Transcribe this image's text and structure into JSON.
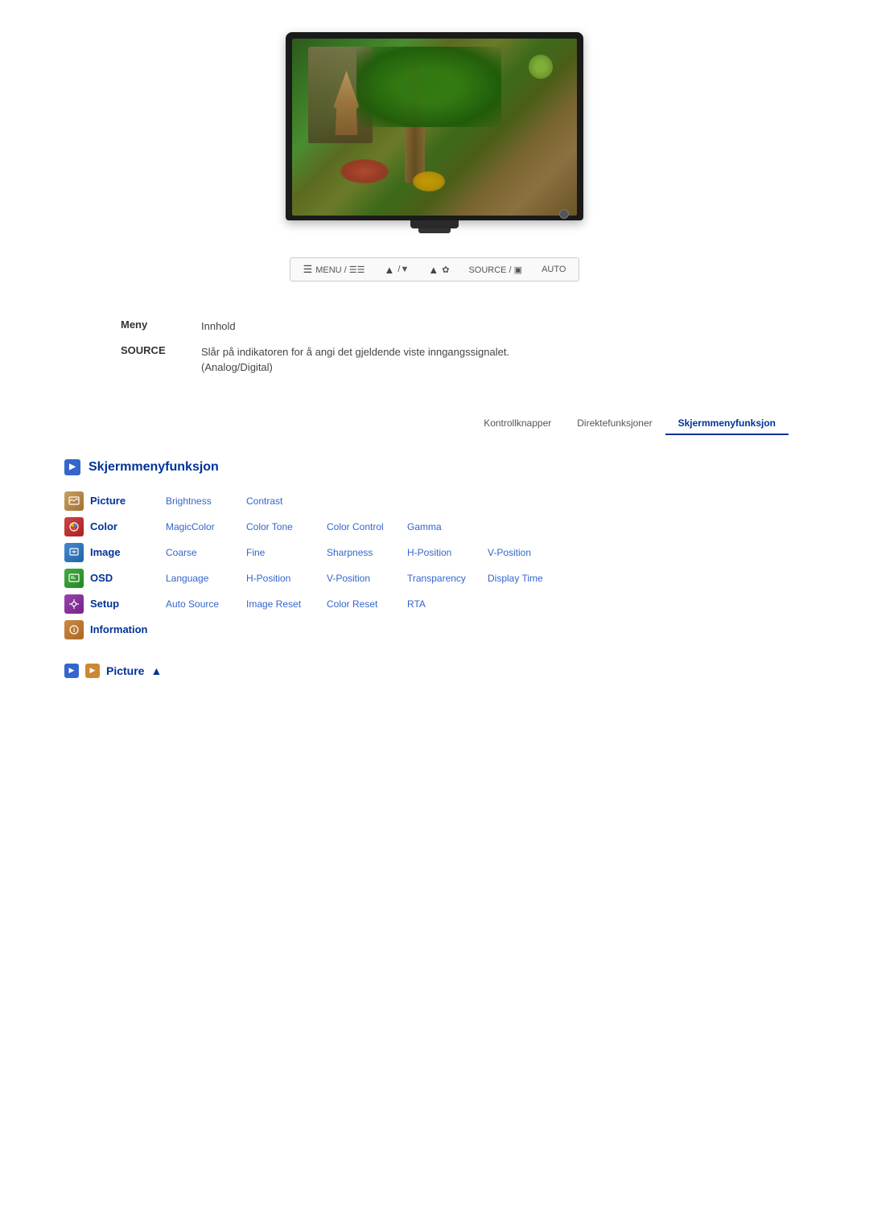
{
  "monitor": {
    "alt": "Samsung monitor displaying garden scene"
  },
  "control_bar": {
    "items": [
      {
        "label": "MENU / ☰☰☰",
        "icon": "menu-icon"
      },
      {
        "label": "▲/▼",
        "icon": "updown-icon"
      },
      {
        "label": "▲ ✿",
        "icon": "brightness-icon"
      },
      {
        "label": "SOURCE / ▣",
        "icon": "source-icon"
      },
      {
        "label": "AUTO",
        "icon": "auto-icon"
      }
    ]
  },
  "info_table": {
    "rows": [
      {
        "label": "Meny",
        "value": "Innhold"
      },
      {
        "label": "SOURCE",
        "value": "Slår på indikatoren for å angi det gjeldende viste inngangssignalet.\n(Analog/Digital)"
      }
    ]
  },
  "tabs": [
    {
      "label": "Kontrollknapper",
      "active": false
    },
    {
      "label": "Direktefunksjoner",
      "active": false
    },
    {
      "label": "Skjermmenyfunksjon",
      "active": true
    }
  ],
  "section": {
    "icon": "▶",
    "title": "Skjermmenyfunksjon"
  },
  "menu_rows": [
    {
      "icon_type": "picture",
      "label": "Picture",
      "items": [
        "Brightness",
        "Contrast"
      ]
    },
    {
      "icon_type": "color",
      "label": "Color",
      "items": [
        "MagicColor",
        "Color Tone",
        "Color Control",
        "Gamma"
      ]
    },
    {
      "icon_type": "image",
      "label": "Image",
      "items": [
        "Coarse",
        "Fine",
        "Sharpness",
        "H-Position",
        "V-Position"
      ]
    },
    {
      "icon_type": "osd",
      "label": "OSD",
      "items": [
        "Language",
        "H-Position",
        "V-Position",
        "Transparency",
        "Display Time"
      ]
    },
    {
      "icon_type": "setup",
      "label": "Setup",
      "items": [
        "Auto Source",
        "Image Reset",
        "Color Reset",
        "RTA"
      ]
    },
    {
      "icon_type": "info",
      "label": "Information",
      "items": []
    }
  ],
  "bottom_nav": {
    "label": "Picture",
    "arrow": "▲"
  }
}
